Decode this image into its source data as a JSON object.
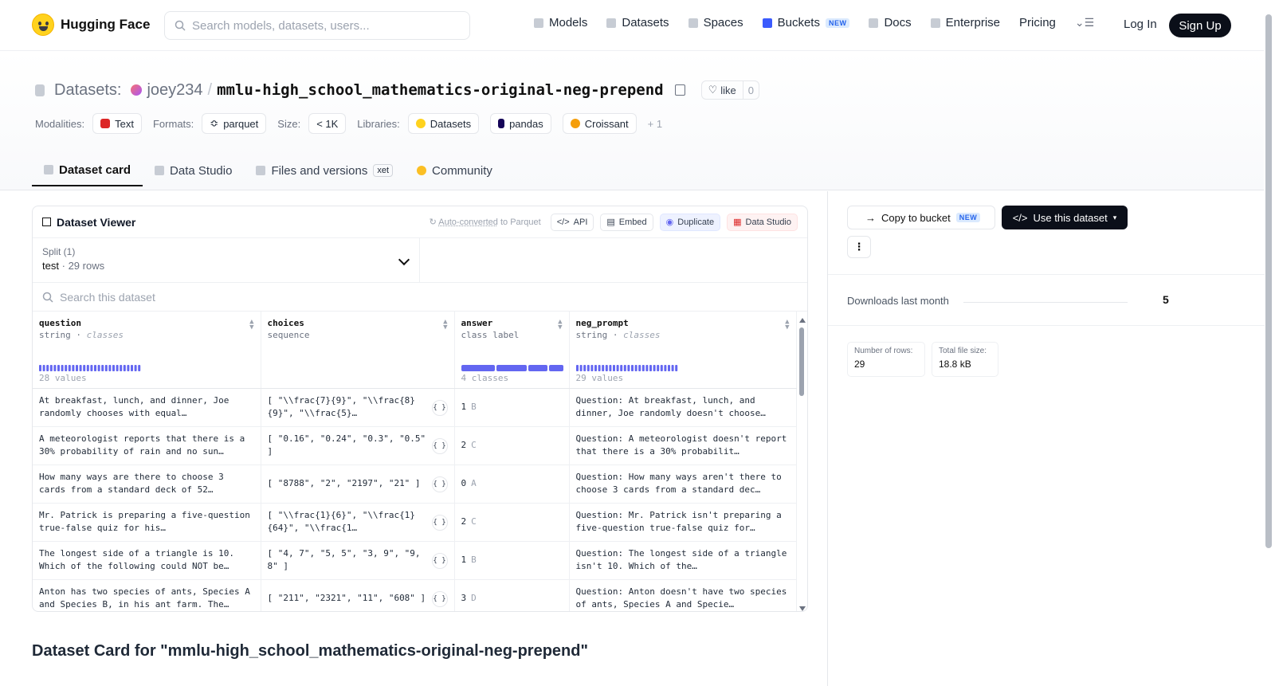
{
  "nav": {
    "brand": "Hugging Face",
    "search_placeholder": "Search models, datasets, users...",
    "links": [
      "Models",
      "Datasets",
      "Spaces",
      "Buckets",
      "Docs",
      "Enterprise",
      "Pricing"
    ],
    "new_badge": "NEW",
    "login": "Log In",
    "signup": "Sign Up"
  },
  "header": {
    "prefix": "Datasets:",
    "user": "joey234",
    "slash": "/",
    "name": "mmlu-high_school_mathematics-original-neg-prepend",
    "like_label": "like",
    "like_count": "0",
    "modalities_label": "Modalities:",
    "modality": "Text",
    "formats_label": "Formats:",
    "format": "parquet",
    "size_label": "Size:",
    "size": "< 1K",
    "libraries_label": "Libraries:",
    "libraries": [
      "Datasets",
      "pandas",
      "Croissant"
    ],
    "more_libraries": "+ 1"
  },
  "tabs": [
    "Dataset card",
    "Data Studio",
    "Files and versions",
    "Community"
  ],
  "xet_badge": "xet",
  "viewer": {
    "title": "Dataset Viewer",
    "auto_converted": "Auto-converted",
    "to_parquet": " to Parquet",
    "btn_api": "API",
    "btn_embed": "Embed",
    "btn_duplicate": "Duplicate",
    "btn_datastudio": "Data Studio",
    "split_label": "Split (1)",
    "split_name": "test",
    "split_sep": "·",
    "split_rows": "29 rows",
    "search_placeholder": "Search this dataset",
    "columns": [
      {
        "name": "question",
        "type": "string",
        "sep": "·",
        "kind": "classes",
        "stats": "28 values"
      },
      {
        "name": "choices",
        "type": "sequence",
        "sep": "",
        "kind": "",
        "stats": ""
      },
      {
        "name": "answer",
        "type": "class label",
        "sep": "",
        "kind": "",
        "stats": "4 classes"
      },
      {
        "name": "neg_prompt",
        "type": "string",
        "sep": "·",
        "kind": "classes",
        "stats": "29 values"
      }
    ],
    "json_btn": "{ }",
    "rows": [
      {
        "question": "At breakfast, lunch, and dinner, Joe randomly chooses with equal…",
        "choices": "[ \"\\\\frac{7}{9}\", \"\\\\frac{8}{9}\", \"\\\\frac{5}…",
        "answer": "1",
        "letter": "B",
        "neg": "Question: At breakfast, lunch, and dinner, Joe randomly doesn't choose…"
      },
      {
        "question": "A meteorologist reports that there is a 30% probability of rain and no sun…",
        "choices": "[ \"0.16\", \"0.24\", \"0.3\", \"0.5\" ]",
        "answer": "2",
        "letter": "C",
        "neg": "Question: A meteorologist doesn't report that there is a 30% probabilit…"
      },
      {
        "question": "How many ways are there to choose 3 cards from a standard deck of 52…",
        "choices": "[ \"8788\", \"2\", \"2197\", \"21\" ]",
        "answer": "0",
        "letter": "A",
        "neg": "Question: How many ways aren't there to choose 3 cards from a standard dec…"
      },
      {
        "question": "Mr. Patrick is preparing a five-question true-false quiz for his…",
        "choices": "[ \"\\\\frac{1}{6}\", \"\\\\frac{1}{64}\", \"\\\\frac{1…",
        "answer": "2",
        "letter": "C",
        "neg": "Question: Mr. Patrick isn't preparing a five-question true-false quiz for…"
      },
      {
        "question": "The longest side of a triangle is 10. Which of the following could NOT be…",
        "choices": "[ \"4, 7\", \"5, 5\", \"3, 9\", \"9, 8\" ]",
        "answer": "1",
        "letter": "B",
        "neg": "Question: The longest side of a triangle isn't 10. Which of the…"
      },
      {
        "question": "Anton has two species of ants, Species A and Species B, in his ant farm. The…",
        "choices": "[ \"211\", \"2321\", \"11\", \"608\" ]",
        "answer": "3",
        "letter": "D",
        "neg": "Question: Anton doesn't have two species of ants, Species A and Specie…"
      }
    ]
  },
  "card_title": "Dataset Card for \"mmlu-high_school_mathematics-original-neg-prepend\"",
  "sidebar": {
    "copy_bucket": "Copy to bucket",
    "new_badge": "NEW",
    "use_dataset": "Use this dataset",
    "more": "⋮",
    "downloads_label": "Downloads last month",
    "downloads": "5",
    "rows_label": "Number of rows:",
    "rows": "29",
    "size_label": "Total file size:",
    "size": "18.8 kB"
  },
  "colors": {
    "accent": "#6366f1",
    "dark": "#0b0f19",
    "brand": "#ffd21e"
  }
}
